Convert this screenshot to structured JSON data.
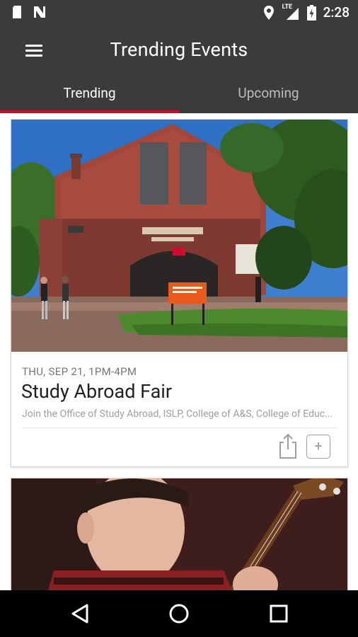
{
  "status_bar": {
    "time": "2:28",
    "network": "LTE",
    "left_icons": [
      "sd-card-icon",
      "no-signal-icon"
    ],
    "right_icons": [
      "location-icon",
      "lte-signal-icon",
      "battery-icon"
    ]
  },
  "app_bar": {
    "title": "Trending Events",
    "background": "#3b3b3b"
  },
  "tabs": [
    {
      "label": "Trending",
      "selected": true
    },
    {
      "label": "Upcoming",
      "selected": false
    }
  ],
  "accent_color": "#c8102e",
  "events": [
    {
      "date": "THU, SEP 21, 1PM-4PM",
      "title": "Study Abroad Fair",
      "description": "Join the Office of Study Abroad, ISLP, College of A&S, College of Educ...",
      "image": "brick-building-photo"
    },
    {
      "image": "guitar-player-photo"
    }
  ],
  "nav_bar": {
    "buttons": [
      "back-icon",
      "home-icon",
      "recents-icon"
    ]
  }
}
